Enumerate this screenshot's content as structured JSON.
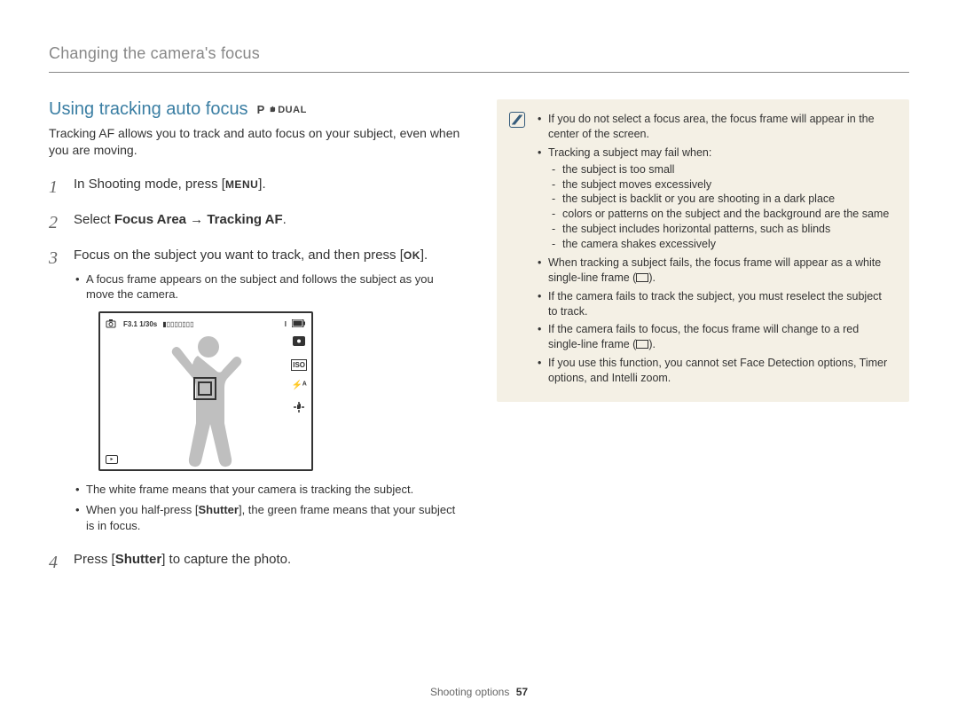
{
  "header": {
    "title": "Changing the camera's focus"
  },
  "section": {
    "title": "Using tracking auto focus",
    "modes": {
      "p": "P",
      "dual": "DUAL"
    },
    "intro": "Tracking AF allows you to track and auto focus on your subject, even when you are moving."
  },
  "steps": {
    "s1_a": "In Shooting mode, press [",
    "s1_menu": "MENU",
    "s1_b": "].",
    "s2_a": "Select ",
    "s2_b": "Focus Area",
    "s2_arrow": " → ",
    "s2_c": "Tracking AF",
    "s2_d": ".",
    "s3_a": "Focus on the subject you want to track, and then press [",
    "s3_ok": "OK",
    "s3_b": "].",
    "s3_sub1": "A focus frame appears on the subject and follows the subject as you move the camera.",
    "s3_sub2": "The white frame means that your camera is tracking the subject.",
    "s3_sub3_a": "When you half-press [",
    "s3_sub3_b": "Shutter",
    "s3_sub3_c": "], the green frame means that your subject is in focus.",
    "s4_a": "Press [",
    "s4_b": "Shutter",
    "s4_c": "] to capture the photo."
  },
  "lcd": {
    "exposure": "F3.1 1/30s",
    "bar": "▮▯▯▯▯▯▯▯",
    "count": "I",
    "iso": "ISO",
    "flash": "⚡ᴬ",
    "hand": "✋"
  },
  "notes": {
    "n1": "If you do not select a focus area, the focus frame will appear in the center of the screen.",
    "n2": "Tracking a subject may fail when:",
    "n2a": "the subject is too small",
    "n2b": "the subject moves excessively",
    "n2c": "the subject is backlit or you are shooting in a dark place",
    "n2d": "colors or patterns on the subject and the background are the same",
    "n2e": "the subject includes horizontal patterns, such as blinds",
    "n2f": "the camera shakes excessively",
    "n3a": "When tracking a subject fails, the focus frame will appear as a white single-line frame (",
    "n3b": ").",
    "n4": "If the camera fails to track the subject, you must reselect the subject to track.",
    "n5a": "If the camera fails to focus, the focus frame will change to a red single-line frame (",
    "n5b": ").",
    "n6": "If you use this function, you cannot set Face Detection options, Timer options, and Intelli zoom."
  },
  "footer": {
    "section": "Shooting options",
    "page": "57"
  }
}
